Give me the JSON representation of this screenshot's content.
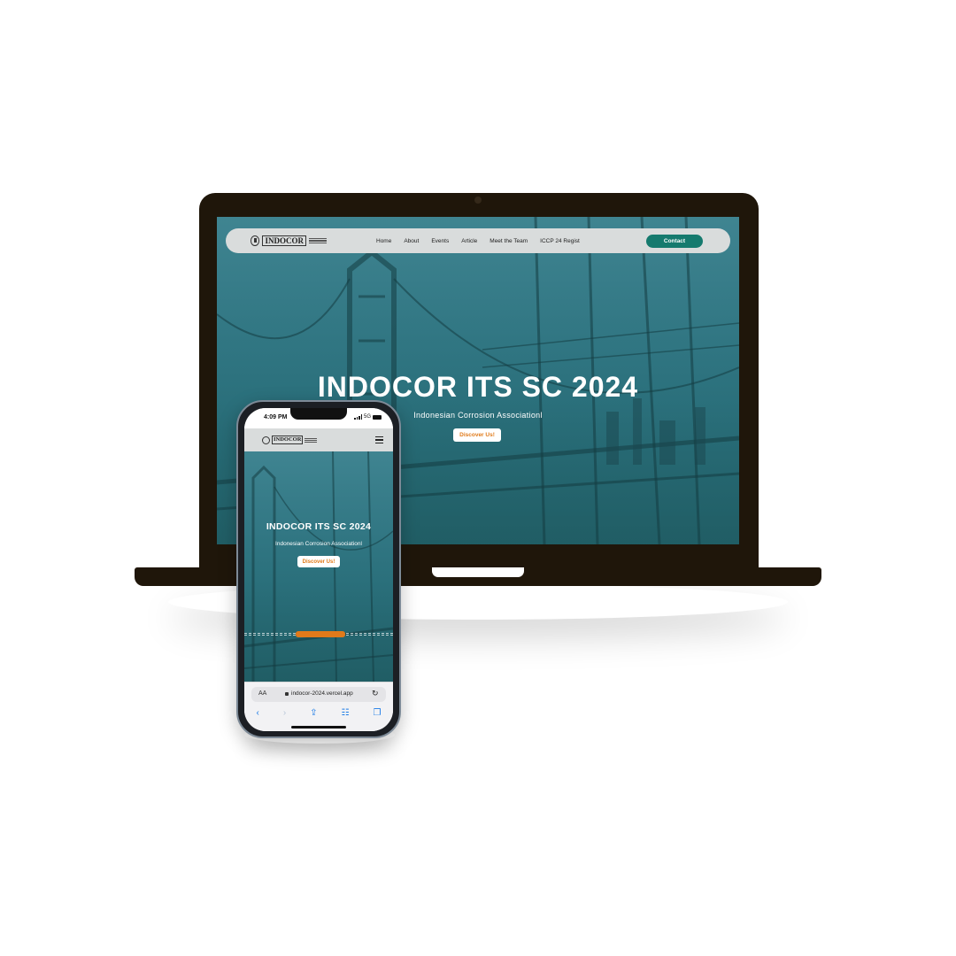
{
  "desktop": {
    "logo_text": "INDOCOR",
    "nav": [
      {
        "label": "Home"
      },
      {
        "label": "About"
      },
      {
        "label": "Events"
      },
      {
        "label": "Article"
      },
      {
        "label": "Meet the Team"
      },
      {
        "label": "ICCP 24 Regist"
      }
    ],
    "contact_label": "Contact",
    "hero_title": "INDOCOR ITS SC 2024",
    "hero_subtitle": "Indonesian Corrosion Associationl",
    "discover_label": "Discover Us!"
  },
  "mobile": {
    "time": "4:09 PM",
    "network": "5G",
    "logo_text": "INDOCOR",
    "hero_title": "INDOCOR ITS SC 2024",
    "hero_subtitle": "Indonesian Corrosion Associationl",
    "discover_label": "Discover Us!",
    "aa_label": "AA",
    "url": "indocor-2024.vercel.app"
  },
  "colors": {
    "hero_overlay": "#257683",
    "contact_button": "#157a6e",
    "discover_text": "#e07a1a",
    "device_body": "#1f160a",
    "navbar": "#d9dcdc",
    "safari_accent": "#1a7ae6"
  },
  "icons": [
    "indocor-emblem-icon",
    "hamburger-menu-icon",
    "lock-icon",
    "reload-icon",
    "back-icon",
    "forward-icon",
    "share-icon",
    "bookmarks-icon",
    "tabs-icon"
  ]
}
